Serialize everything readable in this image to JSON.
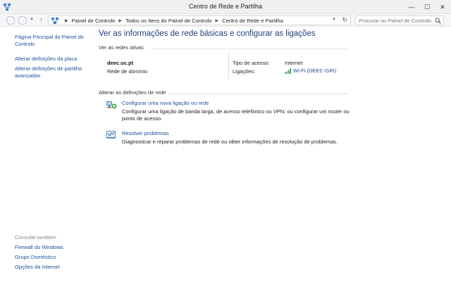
{
  "window": {
    "title": "Centro de Rede e Partilha",
    "controls": {
      "minimize": "—",
      "maximize": "☐",
      "close": "✕"
    }
  },
  "toolbar": {
    "breadcrumbs": [
      "Painel de Controlo",
      "Todos os Itens do Painel de Controlo",
      "Centro de Rede e Partilha"
    ],
    "search_placeholder": "Procurar no Painel de Controlo",
    "icons": {
      "back": "back-arrow-icon",
      "forward": "forward-arrow-icon",
      "up": "up-arrow-icon",
      "refresh": "refresh-icon",
      "search": "search-icon"
    }
  },
  "sidebar": {
    "links": [
      {
        "label": "Página Principal do Painel de Controlo"
      },
      {
        "label": "Alterar definições da placa"
      },
      {
        "label": "Alterar definições de partilha avançadas"
      }
    ],
    "see_also_title": "Consulte também",
    "see_also": [
      {
        "label": "Firewall do Windows"
      },
      {
        "label": "Grupo Doméstico"
      },
      {
        "label": "Opções da Internet"
      }
    ]
  },
  "main": {
    "heading": "Ver as informações de rede básicas e configurar as ligações",
    "active_networks_label": "Ver as redes ativas",
    "network": {
      "name": "deec.uc.pt",
      "type": "Rede de domínio",
      "access_type_label": "Tipo de acesso:",
      "access_type_value": "Internet",
      "connections_label": "Ligações:",
      "connection_value": "Wi-Fi (DEEC-GRI)"
    },
    "change_settings_label": "Alterar as definições de rede",
    "tasks": [
      {
        "title": "Configurar uma nova ligação ou rede",
        "description": "Configurar uma ligação de banda larga, de acesso telefónico ou VPN; ou configurar um router ou ponto de acesso.",
        "icon": "new-connection-icon"
      },
      {
        "title": "Resolver problemas",
        "description": "Diagnosticar e reparar problemas de rede ou obter informações de resolução de problemas.",
        "icon": "troubleshoot-icon"
      }
    ]
  },
  "colors": {
    "link": "#1e4f9c",
    "heading": "#1e3f7a",
    "muted": "#8a8a8a"
  }
}
